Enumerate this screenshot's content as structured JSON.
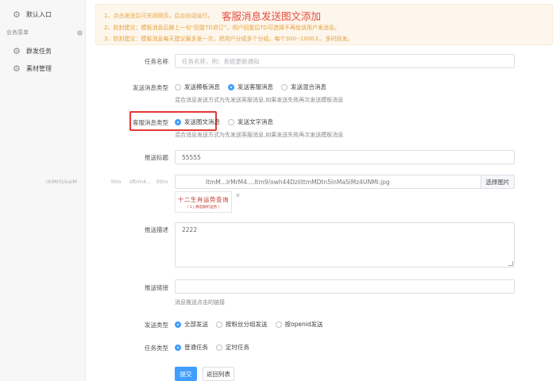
{
  "sidebar": {
    "items": [
      {
        "label": "默认入口",
        "icon": "gear-icon"
      },
      {
        "label": "群发任务",
        "icon": "gear-icon"
      },
      {
        "label": "素材管理",
        "icon": "gear-icon"
      }
    ],
    "section_label": "业务菜单"
  },
  "notice": {
    "line1": "1、点击发送后可关闭网页，后台自动运行。",
    "line2": "2、防封建议：模板消息后跟上一句“回复TD退订”，用户回复后TD可选择不再给该用户发消息。",
    "line3": "3、防封建议：模板消息每天建议最多发一次，把用户分成多个分组，每个300--1000人，多时段发。",
    "title": "客服消息发送图文添加",
    "color": "#e6a23c",
    "title_color": "#e84c3d"
  },
  "form": {
    "task_name": {
      "label": "任务名称",
      "placeholder": "任务名称，例：系统更新通知"
    },
    "send_msg_type": {
      "label": "发送消息类型",
      "options": [
        "发送模板消息",
        "发送客服消息",
        "发送混合消息"
      ],
      "selected": 1,
      "hint": "混合消息发送方式为先发送客服消息,如果发送失败再次发送模板消息"
    },
    "kf_msg_type": {
      "label": "客服消息类型",
      "options": [
        "发送图文消息",
        "发送文字消息"
      ],
      "selected": 0,
      "hint": "混合消息发送方式为先发送客服消息,如果发送失败再次发送模板消息"
    },
    "push_title": {
      "label": "推送标题",
      "value": "55555"
    },
    "push_image": {
      "value": "ltmM...lrMrM4....ltm9/owh44DzlittmMDtn5InMa5lMz4UNMl.jpg",
      "button": "选择图片",
      "garble1": "iXiMrO/oaiM",
      "garble2": "litm",
      "garble3": "sftrm4...",
      "garble4": "litlm",
      "thumb_title": "十二生肖运势查询",
      "thumb_sub": "（ 1 | 精选解析运势 ）"
    },
    "push_desc": {
      "label": "推送描述",
      "value": "2222"
    },
    "push_link": {
      "label": "推送链接",
      "value": "",
      "hint": "消息推送点击的链接"
    },
    "send_type": {
      "label": "发送类型",
      "options": [
        "全部发送",
        "按粉丝分组发送",
        "按openid发送"
      ],
      "selected": 0
    },
    "task_type": {
      "label": "任务类型",
      "options": [
        "普通任务",
        "定时任务"
      ],
      "selected": 0
    },
    "submit": "提交",
    "back": "返回列表",
    "accent": "#409eff"
  }
}
